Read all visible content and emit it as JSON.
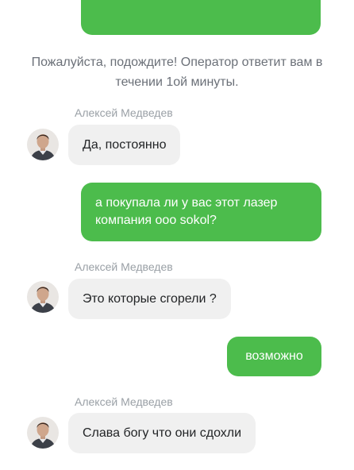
{
  "system_message": "Пожалуйста, подождите! Оператор ответит вам в течении 1ой минуты.",
  "operator_name": "Алексей Медведев",
  "messages": [
    {
      "from": "operator",
      "sender": "",
      "text": "Да, постоянно"
    },
    {
      "from": "user",
      "text": "а покупала ли у вас этот лазер компания ооо sokol?"
    },
    {
      "from": "operator",
      "sender": "Алексей Медведев",
      "text": "Это которые сгорели ?"
    },
    {
      "from": "user",
      "text": "возможно"
    },
    {
      "from": "operator",
      "sender": "Алексей Медведев",
      "text": "Слава богу что они сдохли"
    }
  ],
  "colors": {
    "outgoing_bubble": "#4cbc4c",
    "incoming_bubble": "#f0f0f0",
    "sender_name": "#9aa0a6",
    "system_text": "#6b7078"
  },
  "icons": {
    "avatar": "operator-avatar-photo"
  }
}
